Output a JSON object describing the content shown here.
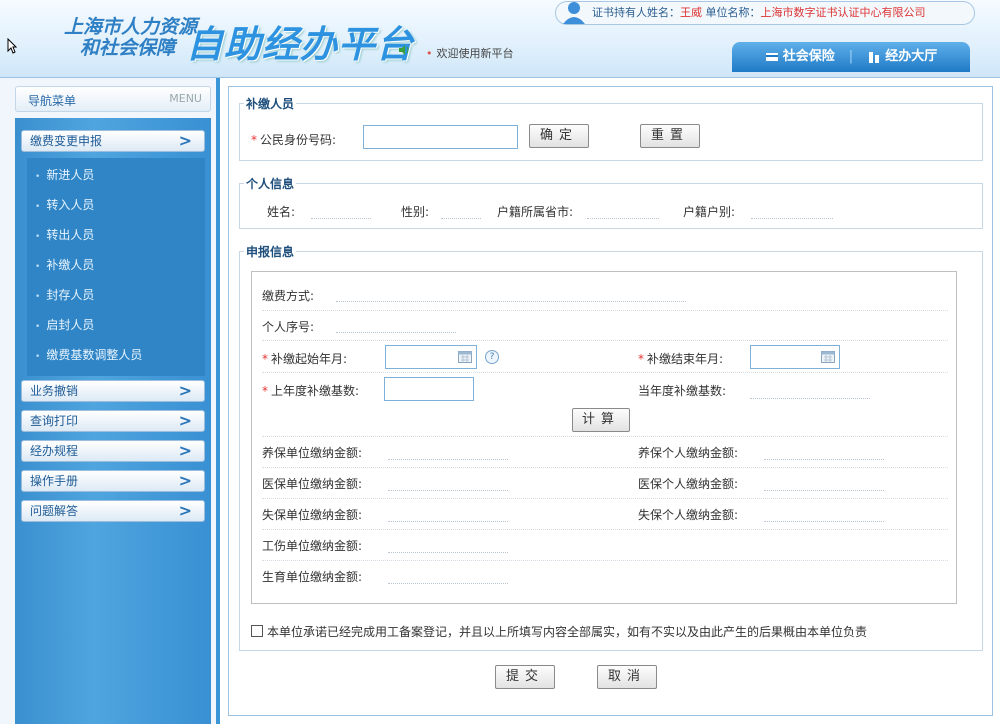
{
  "header": {
    "logo_line1": "上海市人力资源",
    "logo_line2": "和社会保障",
    "logo_main": "自助经办平台",
    "welcome": "欢迎使用新平台",
    "user_label": "证书持有人姓名：",
    "user_name": "王威",
    "unit_label": " 单位名称：",
    "unit_name": "上海市数字证书认证中心有限公司",
    "nav": [
      "社会保险",
      "经办大厅"
    ]
  },
  "sidebar": {
    "menu_title": "导航菜单",
    "menu_en": "MENU",
    "active_group": "缴费变更申报",
    "sub_items": [
      "新进人员",
      "转入人员",
      "转出人员",
      "补缴人员",
      "封存人员",
      "启封人员",
      "缴费基数调整人员"
    ],
    "groups": [
      "业务撤销",
      "查询打印",
      "经办规程",
      "操作手册",
      "问题解答"
    ]
  },
  "form": {
    "section1_title": "补缴人员",
    "id_label": "公民身份号码:",
    "id_value": "",
    "confirm_btn": "确定",
    "reset_btn": "重置",
    "section2_title": "个人信息",
    "name_label": "姓名:",
    "gender_label": "性别:",
    "hukou_province_label": "户籍所属省市:",
    "hukou_type_label": "户籍户别:",
    "section3_title": "申报信息",
    "pay_mode_label": "缴费方式:",
    "person_seq_label": "个人序号:",
    "start_month_label": "补缴起始年月:",
    "end_month_label": "补缴结束年月:",
    "last_year_base_label": "上年度补缴基数:",
    "this_year_base_label": "当年度补缴基数:",
    "calc_btn": "计算",
    "pension_unit_label": "养保单位缴纳金额:",
    "pension_person_label": "养保个人缴纳金额:",
    "medical_unit_label": "医保单位缴纳金额:",
    "medical_person_label": "医保个人缴纳金额:",
    "unemp_unit_label": "失保单位缴纳金额:",
    "unemp_person_label": "失保个人缴纳金额:",
    "injury_unit_label": "工伤单位缴纳金额:",
    "maternity_unit_label": "生育单位缴纳金额:",
    "commitment": "本单位承诺已经完成用工备案登记，并且以上所填写内容全部属实，如有不实以及由此产生的后果概由本单位负责",
    "commitment_checked": false,
    "submit_btn": "提交",
    "cancel_btn": "取消"
  },
  "colors": {
    "accent": "#3a96d6",
    "required": "#e33333",
    "section_title": "#1f4f7c"
  }
}
